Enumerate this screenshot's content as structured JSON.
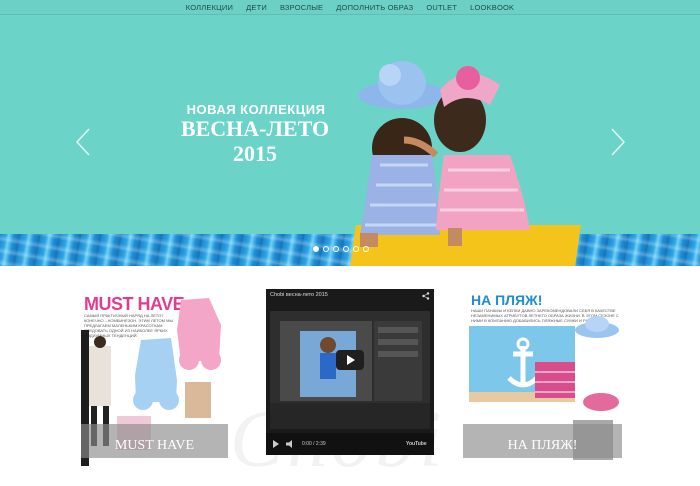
{
  "nav": {
    "items": [
      "КОЛЛЕКЦИИ",
      "ДЕТИ",
      "ВЗРОСЛЫЕ",
      "ДОПОЛНИТЬ ОБРАЗ",
      "OUTLET",
      "LOOKBOOK"
    ]
  },
  "hero": {
    "subtitle": "НОВАЯ КОЛЛЕКЦИЯ",
    "title": "ВЕСНА-ЛЕТО",
    "year": "2015",
    "slides_total": 6,
    "active_slide": 1
  },
  "cards": {
    "must_have": {
      "heading": "MUST HAVE",
      "text": "САМЫЙ ПРАКТИЧНЫЙ НАРЯД НА ЛЕТО? КОНЕЧНО – КОМБИНЕЗОН. ЭТИМ ЛЕТОМ МЫ ПРЕДЛАГАЕМ МАЛЕНЬКИМ КРАСОТКАМ СЛЕДОВАТЬ ОДНОЙ ИЗ НАИБОЛЕЕ ЯРКИХ ПОДИУМНЫХ ТЕНДЕНЦИЙ.",
      "caption": "MUST HAVE"
    },
    "video": {
      "title": "Chobi весна-лето 2015",
      "time": "0:00 / 2:39",
      "brand": "YouTube"
    },
    "beach": {
      "heading": "НА ПЛЯЖ!",
      "text": "НАШИ ПАНАМЫ И КЕПКИ ДАВНО ЗАРЕКОМЕНДОВАЛИ СЕБЯ В КАЧЕСТВЕ НЕЗАМЕНИМЫХ АТРИБУТОВ ЛЕТНЕГО ОБРАЗА ЖИЗНИ. В ЭТОМ СЕЗОНЕ С НИМИ В КОМПАНИЮ ДОБАВИЛИСЬ ПЛЯЖНЫЕ СУМКИ И РЮКЗАКИ",
      "caption": "НА ПЛЯЖ!"
    }
  },
  "colors": {
    "hero_bg": "#6bd3c8",
    "nav_bg": "#6dd0c6",
    "accent_pink": "#e23c8f",
    "accent_blue": "#1f8bd1",
    "block_yellow": "#f5c41b"
  }
}
